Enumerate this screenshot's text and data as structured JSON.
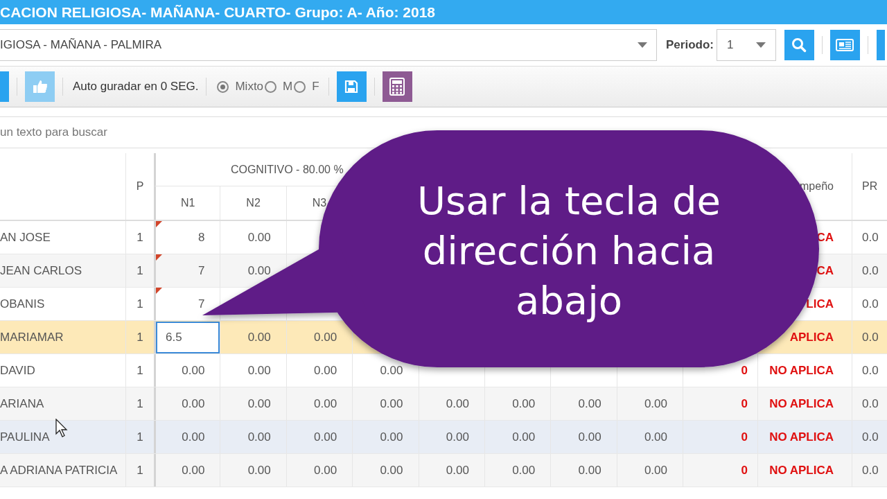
{
  "header": {
    "title": "CACION RELIGIOSA- MAÑANA- CUARTO- Grupo: A- Año: 2018"
  },
  "filters": {
    "course": "IGIOSA - MAÑANA - PALMIRA",
    "period_label": "Periodo:",
    "period": "1"
  },
  "toolbar": {
    "autosave": "Auto guradar en 0 SEG.",
    "gender_options": [
      {
        "label": "Mixto",
        "selected": true
      },
      {
        "label": "M",
        "selected": false
      },
      {
        "label": "F",
        "selected": false
      }
    ]
  },
  "search": {
    "placeholder": "un texto para buscar"
  },
  "table": {
    "p_header": "P",
    "group_header": "COGNITIVO - 80.00 %",
    "subcolumns": [
      "N1",
      "N2",
      "N3"
    ],
    "desempeno_header": "mpeño",
    "pro_header": "PR",
    "rows": [
      {
        "name": "AN JOSE",
        "p": "1",
        "marked": true,
        "selected": false,
        "hovered": false,
        "editing": false,
        "cells": [
          "8",
          "0.00",
          null,
          null,
          null,
          null,
          null,
          null
        ],
        "score": null,
        "desempeno": "CA",
        "pro": "0.0"
      },
      {
        "name": "JEAN CARLOS",
        "p": "1",
        "marked": true,
        "selected": false,
        "hovered": false,
        "editing": false,
        "cells": [
          "7",
          "0.00",
          null,
          null,
          null,
          null,
          null,
          null
        ],
        "score": null,
        "desempeno": "CA",
        "pro": "0.0"
      },
      {
        "name": "OBANIS",
        "p": "1",
        "marked": true,
        "selected": false,
        "hovered": false,
        "editing": false,
        "cells": [
          "7",
          null,
          null,
          null,
          null,
          null,
          null,
          null
        ],
        "score": null,
        "desempeno": "LICA",
        "pro": "0.0"
      },
      {
        "name": "MARIAMAR",
        "p": "1",
        "marked": false,
        "selected": true,
        "hovered": false,
        "editing": true,
        "cells": [
          "6.5",
          "0.00",
          "0.00",
          null,
          null,
          null,
          null,
          null
        ],
        "score": null,
        "desempeno": "APLICA",
        "pro": "0.0"
      },
      {
        "name": "DAVID",
        "p": "1",
        "marked": false,
        "selected": false,
        "hovered": false,
        "editing": false,
        "cells": [
          "0.00",
          "0.00",
          "0.00",
          "0.00",
          null,
          null,
          null,
          null
        ],
        "score": "0",
        "desempeno": "NO APLICA",
        "pro": "0.0"
      },
      {
        "name": "ARIANA",
        "p": "1",
        "marked": false,
        "selected": false,
        "hovered": false,
        "editing": false,
        "cells": [
          "0.00",
          "0.00",
          "0.00",
          "0.00",
          "0.00",
          "0.00",
          "0.00",
          "0.00"
        ],
        "score": "0",
        "desempeno": "NO APLICA",
        "pro": "0.0"
      },
      {
        "name": "PAULINA",
        "p": "1",
        "marked": false,
        "selected": false,
        "hovered": true,
        "editing": false,
        "cells": [
          "0.00",
          "0.00",
          "0.00",
          "0.00",
          "0.00",
          "0.00",
          "0.00",
          "0.00"
        ],
        "score": "0",
        "desempeno": "NO APLICA",
        "pro": "0.0"
      },
      {
        "name": "A ADRIANA PATRICIA",
        "p": "1",
        "marked": false,
        "selected": false,
        "hovered": false,
        "editing": false,
        "cells": [
          "0.00",
          "0.00",
          "0.00",
          "0.00",
          "0.00",
          "0.00",
          "0.00",
          "0.00"
        ],
        "score": "0",
        "desempeno": "NO APLICA",
        "pro": "0.0"
      }
    ]
  },
  "callout": {
    "text": "Usar la tecla de dirección hacia abajo"
  }
}
